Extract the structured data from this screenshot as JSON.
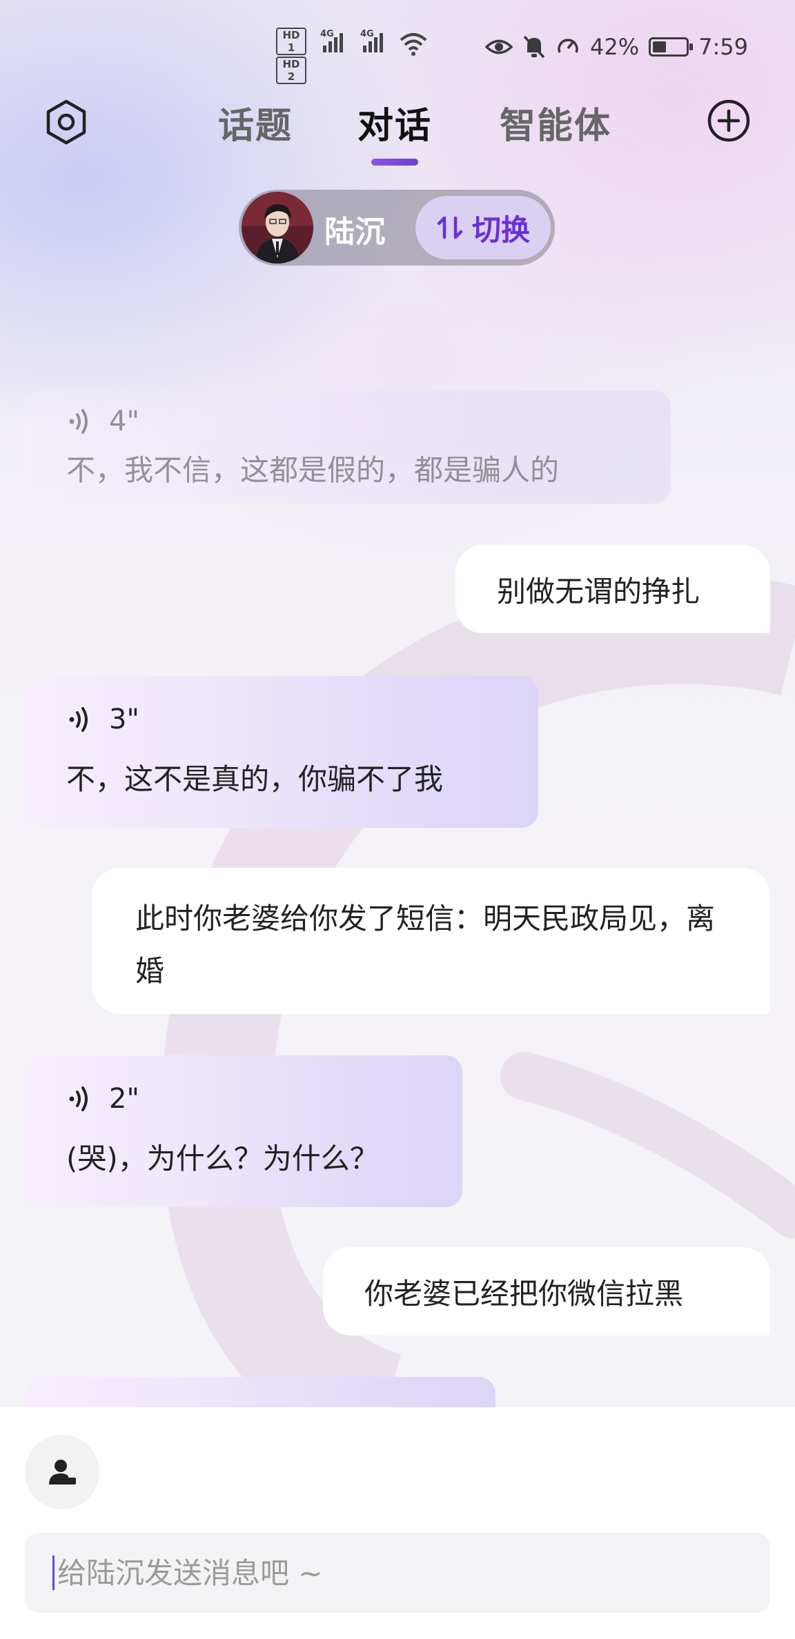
{
  "status_bar": {
    "hd1": "HD 1",
    "hd2": "HD 2",
    "net1": "4G",
    "net2": "4G",
    "battery_pct": "42%",
    "battery_level": 0.42,
    "time": "7:59",
    "icons": [
      "eye-icon",
      "bell-muted-icon",
      "speed-icon",
      "wifi-icon"
    ]
  },
  "header": {
    "tabs": [
      {
        "label": "话题",
        "active": false
      },
      {
        "label": "对话",
        "active": true
      },
      {
        "label": "智能体",
        "active": false
      }
    ]
  },
  "character": {
    "name": "陆沉",
    "switch_label": "切换"
  },
  "messages": [
    {
      "role": "bot",
      "duration": "4\"",
      "text": "不，我不信，这都是假的，都是骗人的"
    },
    {
      "role": "user",
      "text": "别做无谓的挣扎"
    },
    {
      "role": "bot",
      "duration": "3\"",
      "text": "不，这不是真的，你骗不了我"
    },
    {
      "role": "user",
      "text": "此时你老婆给你发了短信：明天民政局见，离婚"
    },
    {
      "role": "bot",
      "duration": "2\"",
      "text": "(哭)，为什么？为什么？"
    },
    {
      "role": "user",
      "text": "你老婆已经把你微信拉黑"
    }
  ],
  "composer": {
    "placeholder": "给陆沉发送消息吧 ~"
  },
  "colors": {
    "accent": "#6a2fd8",
    "bubble_user": "#ffffff",
    "bubble_bot_start": "#f6eefb",
    "bubble_bot_end": "#dcd5f7"
  }
}
